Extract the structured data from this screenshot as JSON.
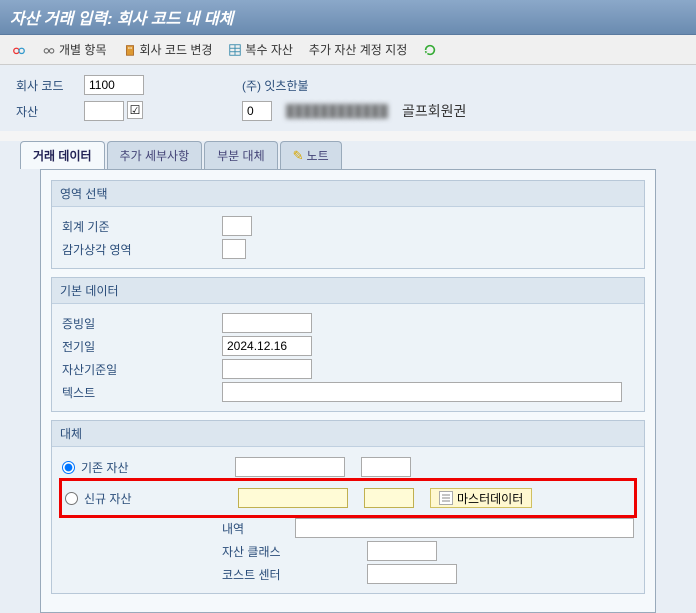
{
  "title": "자산 거래 입력: 회사 코드 내 대체",
  "toolbar": {
    "individual_item": "개별 항목",
    "change_company_code": "회사 코드 변경",
    "multi_asset": "복수 자산",
    "add_account_assign": "추가 자산 계정 지정"
  },
  "header": {
    "company_code_label": "회사 코드",
    "company_code_value": "1100",
    "company_name": "(주) 잇츠한불",
    "asset_label": "자산",
    "asset_value": "",
    "sub_value": "0",
    "desc_suffix": "골프회원권"
  },
  "tabs": {
    "transaction_data": "거래 데이터",
    "additional_detail": "추가 세부사항",
    "partial_transfer": "부분 대체",
    "note": "노트"
  },
  "area_select": {
    "title": "영역 선택",
    "acc_principle": "회계 기준",
    "deprec_area": "감가상각 영역"
  },
  "basic_data": {
    "title": "기본 데이터",
    "doc_date": "증빙일",
    "posting_date_label": "전기일",
    "posting_date_value": "2024.12.16",
    "asset_value_date": "자산기준일",
    "text": "텍스트"
  },
  "transfer": {
    "title": "대체",
    "existing_asset": "기존 자산",
    "new_asset": "신규 자산",
    "master_data": "마스터데이터",
    "description": "내역",
    "asset_class": "자산 클래스",
    "cost_center": "코스트 센터"
  }
}
